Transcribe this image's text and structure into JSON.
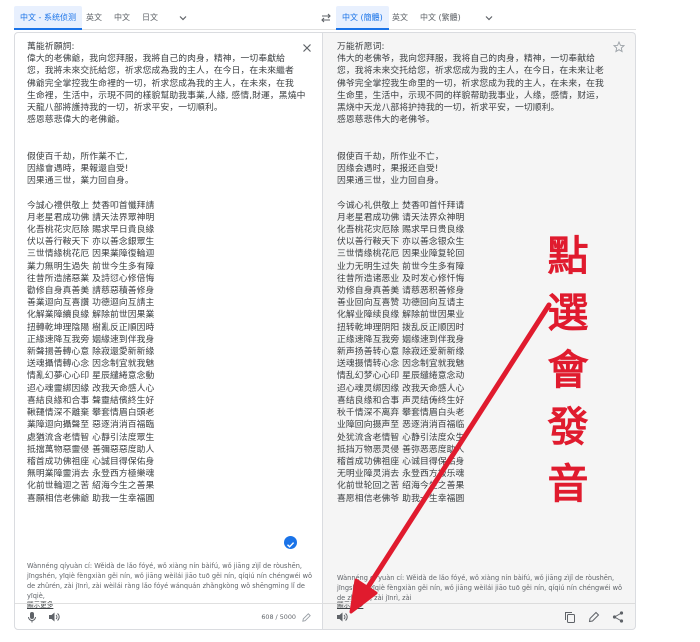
{
  "source_tabs": [
    {
      "label": "中文 - 系统侦测",
      "active": true
    },
    {
      "label": "英文",
      "active": false
    },
    {
      "label": "中文",
      "active": false
    },
    {
      "label": "日文",
      "active": false
    }
  ],
  "target_tabs": [
    {
      "label": "中文 (簡體)",
      "active": true
    },
    {
      "label": "英文",
      "active": false
    },
    {
      "label": "中文 (繁體)",
      "active": false
    }
  ],
  "source_text": "萬能祈願詞:\n偉大的老佛爺，我向您拜服，我將自己的肉身，精神，一切奉獻給\n您，我將未來交託給您，祈求您成為我的主人，在今日，在未來繼者\n佛爺完全掌控我生命裡的一切，祈求您成為我的主人，在未來，在我\n生命裡，生活中，示現不同的樣貌幫助我事業,人緣, 感情,財運，黑燒中\n天龍八部將護持我的一切，祈求平安，一切順利。\n感恩慈悲偉大的老佛爺。\n\n\n假使百千劫，所作業不亡,\n因緣會遇時，果報還自受!\n因果通三世，業力回自身。\n\n今誠心禮供敬上 焚香叩首懺拜請\n月老星君成功佛 請天法界眾神明\n化吾桃花灾厄除 賜求早日貴良緣\n伏以善行鞍天下 亦以善念銀眾生\n三世情緣桃花厄 因果業障復輪迴\n業力無明生過失 前世今生多有障\n往昔所造諸惡業 及詩愆心修倍悔\n勸修自身真善美 請慈惡積善修身\n善業迴向互喜讚 功德迴向互請主\n化解業障續良緣 解除前世因果業\n扭轉乾坤理陰陽 樹亂反正順因時\n正緣速降互我旁 姻緣速到伴我身\n新聲揚善轉心意 除寂還愛新新緣\n送魂攝情轉心念 因念制宜就我魅\n情亂幻夢心心印 星辰繾綣意念動\n迢心魂靈綁因緣 改我天命感人心\n喜結良緣和合事 聲靈結儐終生好\n鞦韆情深不離棄 攀套情眉白頭老\n業障迴向攝聲至 惡逐消消百福臨\n處猶流含老情智 心靜引法度眾生\n抵擋萬物惡靈侵 善彌惡惡度助人\n稽首成功佛祖座 心誠目得保佑身\n無明業障靈消去 永登西方極樂魂\n化前世輪迴之苦 紹海今生之善果\n喜願相信老佛爺 助我一生幸福圓",
  "target_text": "万能祈愿词:\n伟大的老佛爷，我向您拜服，我将自己的肉身，精神，一切奉献给\n您，我将未来交托给您，祈求您成为我的主人，在今日，在未来让老\n佛爷完全掌控我生命里的一切，祈求您成为我的主人，在未来，在我\n生命里，生活中，示现不同的样貌帮助我事业，人缘，感情，财运，\n黑烧中天龙八部将护持我的一切，祈求平安，一切顺利。\n感恩慈悲伟大的老佛爷。\n\n\n假使百千劫，所作业不亡，\n因缘会遇时，果报还自受!\n因果通三世，业力回自身。\n\n今诚心礼供敬上 焚香叩首忏拜请\n月老星君成功佛 请天法界众神明\n化吾桃花灾厄除 赐求早日贵良缘\n伏以善行鞍天下 亦以善念银众生\n三世情缘桃花厄 因果业障复轮回\n业力无明生过失 前世今生多有障\n往昔所造诸恶业 及时发心修忏悔\n劝修自身真善美 请慈恶积善修身\n善业回向互喜赞 功德回向互请主\n化解业障续良缘 解除前世因果业\n扭转乾坤理阴阳 拨乱反正顺因时\n正缘速降互我旁 姻缘速到伴我身\n新声扬善转心意 除寂还爱新新缘\n送魂摄情转心念 因念制宜就我魅\n情乱幻梦心心印 星辰缱绻意念动\n迢心魂灵绑因缘 改我天命感人心\n喜结良缘和合事 声灵结俦终生好\n秋千情深不离弃 攀套情眉白头老\n业障回向摄声至 恶逐消消百福临\n处犹流含老情智 心静引法度众生\n抵挡万物恶灵侵 善弥恶恶度助人\n稽首成功佛祖座 心诚目得保佑身\n无明业障灵消去 永登西方极乐魂\n化前世轮回之苦 绍海今生之善果\n喜愿相信老佛爷 助我一生幸福圆",
  "source_romanization": "Wànnéng qíyuàn cí: Wěidà de lǎo fóyé, wǒ xiàng nín bàifú, wǒ jiāng zìjǐ de ròushēn, jīngshén, yīqiè fèngxiàn gěi nín, wǒ jiāng wèilái jiāo tuō gěi nín, qíqiú nín chéngwéi wǒ de zhǔrén, zài jīnrì, zài wèilái ràng lǎo fóyé wánquán zhǎngkòng wǒ shēngmìng lǐ de yīqiè,",
  "target_romanization": "Wànnéng qí yuàn cí: Wěidà de lǎo fóyé, wǒ xiàng nín bàifú, wǒ jiāng zìjǐ de ròushēn, jīngshén, yīqiè fèngxiàn gěi nín, wǒ jiāng wèilái jiāo tuō gěi nín, qíqiú nín chéngwéi wǒ de zhǔrén, zài jīnrì, zài",
  "show_more_label": "顯示更多",
  "char_count": "608 / 5000",
  "annotation": "點\n選\n會\n發\n音",
  "colors": {
    "accent": "#1a73e8",
    "annotation": "#e01b2e"
  },
  "icons": [
    "swap-icon",
    "close-icon",
    "star-icon",
    "mic-icon",
    "speaker-icon",
    "pencil-icon",
    "copy-icon",
    "share-icon",
    "check-icon",
    "chevron-down-icon"
  ]
}
